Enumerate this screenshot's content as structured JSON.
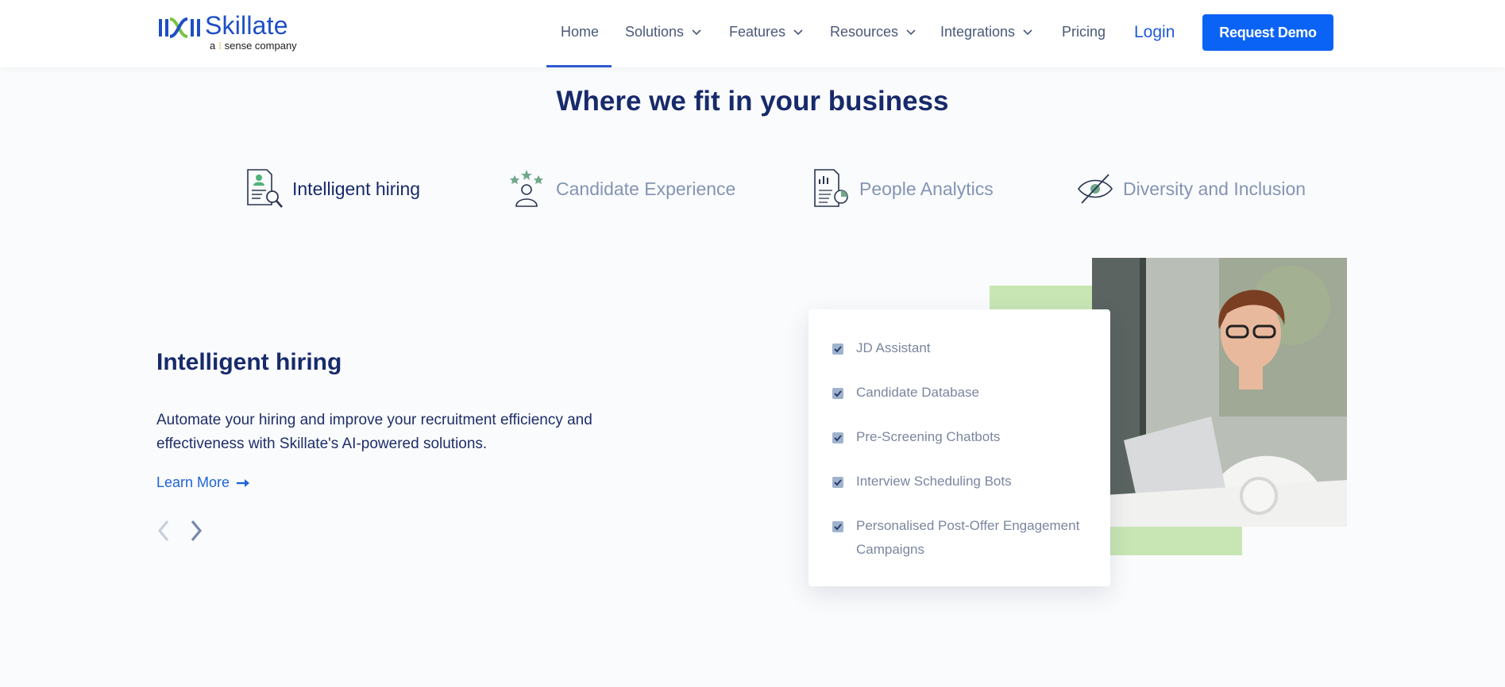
{
  "header": {
    "logo_name": "Skillate",
    "logo_tag_prefix": "a",
    "logo_tag_suffix": "sense company",
    "nav": [
      {
        "label": "Home",
        "has_dropdown": false,
        "active": true
      },
      {
        "label": "Solutions",
        "has_dropdown": true
      },
      {
        "label": "Features",
        "has_dropdown": true
      },
      {
        "label": "Resources",
        "has_dropdown": true
      },
      {
        "label": "Integrations",
        "has_dropdown": true
      },
      {
        "label": "Pricing",
        "has_dropdown": false
      }
    ],
    "login_label": "Login",
    "demo_label": "Request Demo"
  },
  "section_title": "Where we fit in your business",
  "tabs": [
    {
      "label": "Intelligent hiring",
      "icon": "hiring-search-icon",
      "active": true
    },
    {
      "label": "Candidate Experience",
      "icon": "candidate-stars-icon",
      "active": false
    },
    {
      "label": "People Analytics",
      "icon": "analytics-report-icon",
      "active": false
    },
    {
      "label": "Diversity and Inclusion",
      "icon": "eye-slash-icon",
      "active": false
    }
  ],
  "content": {
    "heading": "Intelligent hiring",
    "body": "Automate your hiring and improve your recruitment efficiency and effectiveness with Skillate's AI-powered solutions.",
    "learn_more": "Learn More"
  },
  "features": [
    "JD Assistant",
    "Candidate Database",
    "Pre-Screening Chatbots",
    "Interview Scheduling Bots",
    "Personalised Post-Offer Engagement Campaigns"
  ],
  "colors": {
    "primary": "#0b63f6",
    "heading": "#172a6b",
    "muted": "#8394b5",
    "accent_green": "#c7e6b4"
  }
}
